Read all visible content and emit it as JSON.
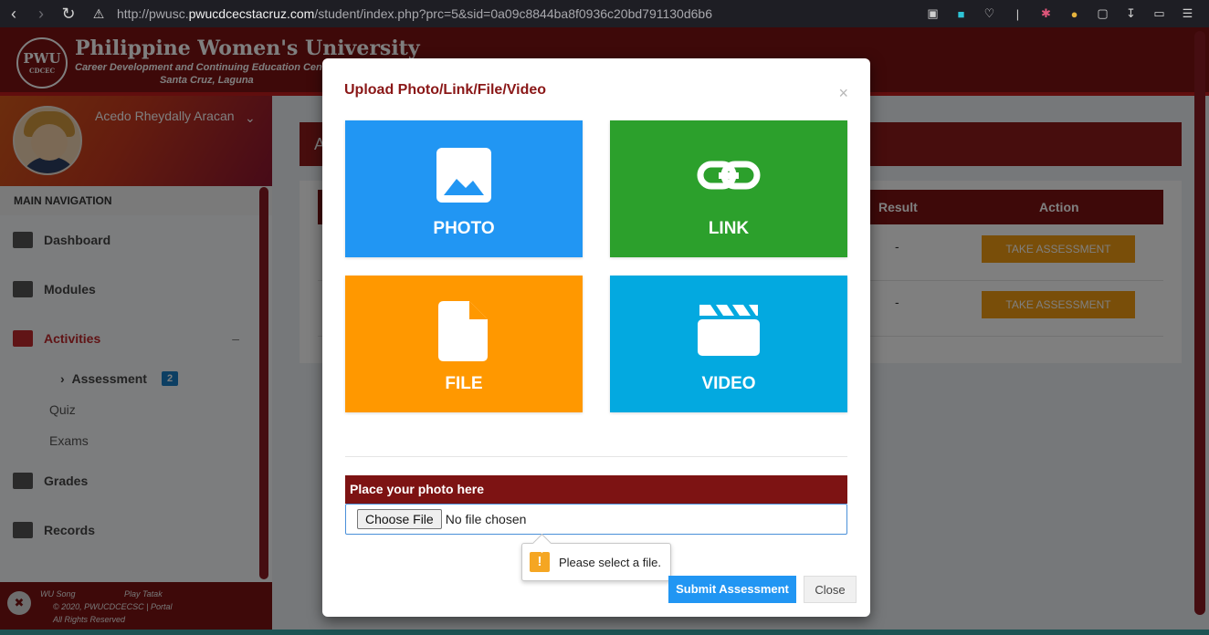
{
  "browser": {
    "url_prefix": "http://pwusc.",
    "url_domain": "pwucdcecstacruz.com",
    "url_path": "/student/index.php?prc=5&sid=0a09c8844ba8f0936c20bd791130d6b6"
  },
  "header": {
    "logo_text": "PWU",
    "logo_sub": "CDCEC",
    "title": "Philippine Women's University",
    "subtitle": "Career Development and Continuing Education Cen",
    "location": "Santa Cruz, Laguna"
  },
  "sidebar": {
    "user_name": "Acedo Rheydally Aracan",
    "nav_header": "MAIN NAVIGATION",
    "items": {
      "dashboard": "Dashboard",
      "modules": "Modules",
      "activities": "Activities",
      "assessment": "Assessment",
      "assessment_count": "2",
      "quiz": "Quiz",
      "exams": "Exams",
      "grades": "Grades",
      "records": "Records"
    },
    "footer": {
      "song": "WU Song",
      "play": "Play Tatak",
      "copyright": "© 2020, PWUCDCECSC | Portal",
      "rights": "All Rights Reserved"
    }
  },
  "main": {
    "box_title": "A",
    "columns": {
      "result": "Result",
      "action": "Action"
    },
    "rows": [
      {
        "result": "-",
        "action": "TAKE ASSESSMENT"
      },
      {
        "result": "-",
        "action": "TAKE ASSESSMENT"
      }
    ]
  },
  "modal": {
    "title": "Upload Photo/Link/File/Video",
    "close_x": "×",
    "tiles": {
      "photo": "PHOTO",
      "link": "LINK",
      "file": "FILE",
      "video": "VIDEO"
    },
    "place_label": "Place your photo here",
    "choose_file": "Choose File",
    "no_file": "No file chosen",
    "validation": "Please select a file.",
    "submit": "Submit Assessment",
    "close": "Close"
  },
  "colors": {
    "brand_maroon": "#7d1313",
    "photo_tile": "#2196f3",
    "link_tile": "#2ca02c",
    "file_tile": "#ff9800",
    "video_tile": "#03a9e0",
    "take_btn": "#f39c12"
  }
}
